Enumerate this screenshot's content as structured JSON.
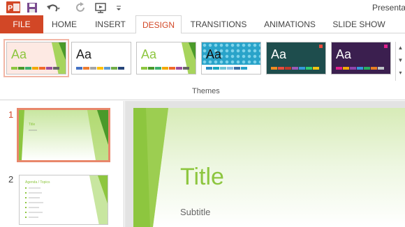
{
  "app": {
    "document_title": "Presentat"
  },
  "quick_access": {
    "icons": [
      "powerpoint-logo-icon",
      "save-icon",
      "undo-icon",
      "redo-icon",
      "start-from-beginning-icon",
      "customize-qat-icon"
    ]
  },
  "tabs": [
    {
      "label": "FILE"
    },
    {
      "label": "HOME"
    },
    {
      "label": "INSERT"
    },
    {
      "label": "DESIGN"
    },
    {
      "label": "TRANSITIONS"
    },
    {
      "label": "ANIMATIONS"
    },
    {
      "label": "SLIDE SHOW"
    }
  ],
  "active_tab": "DESIGN",
  "themes": {
    "group_label": "Themes",
    "items": [
      {
        "label": "Aa",
        "bg": "#ffffff",
        "text": "#8dc63f",
        "bars": [
          "#8dc63f",
          "#4a9a2a",
          "#3bb06e",
          "#f2a900",
          "#f06a2a",
          "#9b4b9e",
          "#666666"
        ]
      },
      {
        "label": "Aa",
        "bg": "#ffffff",
        "text": "#222222",
        "bars": [
          "#4472c4",
          "#ed7d31",
          "#a5a5a5",
          "#ffc000",
          "#5b9bd5",
          "#70ad47",
          "#264478"
        ]
      },
      {
        "label": "Aa",
        "bg": "#ffffff",
        "text": "#8dc63f",
        "bars": [
          "#8dc63f",
          "#4a9a2a",
          "#3bb06e",
          "#f2a900",
          "#f06a2a",
          "#9b4b9e",
          "#666666"
        ]
      },
      {
        "label": "Aa",
        "bg": "#29a3c9",
        "text": "#111111",
        "bars": [
          "#2a8fc4",
          "#19a7bf",
          "#6dc3d5",
          "#8bc1e4",
          "#3b6fa6",
          "#2aa2c9",
          "#ffffff"
        ]
      },
      {
        "label": "Aa",
        "bg": "#1e4d4d",
        "text": "#ffffff",
        "bars": [
          "#f28b20",
          "#e84b3c",
          "#c0392b",
          "#9b59b6",
          "#3498db",
          "#2ecc71",
          "#f1c40f"
        ]
      },
      {
        "label": "Aa",
        "bg": "#3b1f4f",
        "text": "#ffffff",
        "bars": [
          "#e01f8c",
          "#f2a900",
          "#8e44ad",
          "#3498db",
          "#27ae60",
          "#e67e22",
          "#bdc3c7"
        ]
      }
    ]
  },
  "slides": [
    {
      "number": "1",
      "title": "Title",
      "subtitle": "Subtitle"
    },
    {
      "number": "2",
      "title": "Agenda / Topics"
    }
  ],
  "editor": {
    "title": "Title",
    "subtitle": "Subtitle"
  },
  "colors": {
    "accent": "#d24726",
    "green": "#8dc63f",
    "dark_green": "#4a9a2a"
  }
}
